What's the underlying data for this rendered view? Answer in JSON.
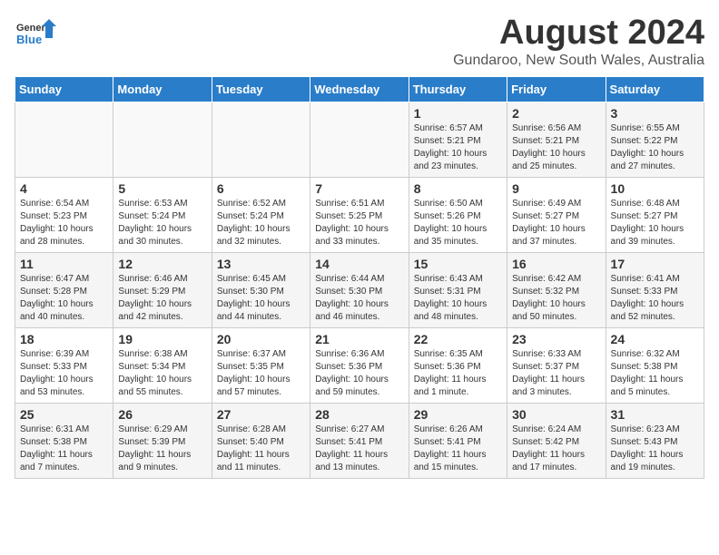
{
  "logo": {
    "line1": "General",
    "line2": "Blue"
  },
  "title": "August 2024",
  "subtitle": "Gundaroo, New South Wales, Australia",
  "days_of_week": [
    "Sunday",
    "Monday",
    "Tuesday",
    "Wednesday",
    "Thursday",
    "Friday",
    "Saturday"
  ],
  "weeks": [
    [
      {
        "day": "",
        "info": ""
      },
      {
        "day": "",
        "info": ""
      },
      {
        "day": "",
        "info": ""
      },
      {
        "day": "",
        "info": ""
      },
      {
        "day": "1",
        "info": "Sunrise: 6:57 AM\nSunset: 5:21 PM\nDaylight: 10 hours\nand 23 minutes."
      },
      {
        "day": "2",
        "info": "Sunrise: 6:56 AM\nSunset: 5:21 PM\nDaylight: 10 hours\nand 25 minutes."
      },
      {
        "day": "3",
        "info": "Sunrise: 6:55 AM\nSunset: 5:22 PM\nDaylight: 10 hours\nand 27 minutes."
      }
    ],
    [
      {
        "day": "4",
        "info": "Sunrise: 6:54 AM\nSunset: 5:23 PM\nDaylight: 10 hours\nand 28 minutes."
      },
      {
        "day": "5",
        "info": "Sunrise: 6:53 AM\nSunset: 5:24 PM\nDaylight: 10 hours\nand 30 minutes."
      },
      {
        "day": "6",
        "info": "Sunrise: 6:52 AM\nSunset: 5:24 PM\nDaylight: 10 hours\nand 32 minutes."
      },
      {
        "day": "7",
        "info": "Sunrise: 6:51 AM\nSunset: 5:25 PM\nDaylight: 10 hours\nand 33 minutes."
      },
      {
        "day": "8",
        "info": "Sunrise: 6:50 AM\nSunset: 5:26 PM\nDaylight: 10 hours\nand 35 minutes."
      },
      {
        "day": "9",
        "info": "Sunrise: 6:49 AM\nSunset: 5:27 PM\nDaylight: 10 hours\nand 37 minutes."
      },
      {
        "day": "10",
        "info": "Sunrise: 6:48 AM\nSunset: 5:27 PM\nDaylight: 10 hours\nand 39 minutes."
      }
    ],
    [
      {
        "day": "11",
        "info": "Sunrise: 6:47 AM\nSunset: 5:28 PM\nDaylight: 10 hours\nand 40 minutes."
      },
      {
        "day": "12",
        "info": "Sunrise: 6:46 AM\nSunset: 5:29 PM\nDaylight: 10 hours\nand 42 minutes."
      },
      {
        "day": "13",
        "info": "Sunrise: 6:45 AM\nSunset: 5:30 PM\nDaylight: 10 hours\nand 44 minutes."
      },
      {
        "day": "14",
        "info": "Sunrise: 6:44 AM\nSunset: 5:30 PM\nDaylight: 10 hours\nand 46 minutes."
      },
      {
        "day": "15",
        "info": "Sunrise: 6:43 AM\nSunset: 5:31 PM\nDaylight: 10 hours\nand 48 minutes."
      },
      {
        "day": "16",
        "info": "Sunrise: 6:42 AM\nSunset: 5:32 PM\nDaylight: 10 hours\nand 50 minutes."
      },
      {
        "day": "17",
        "info": "Sunrise: 6:41 AM\nSunset: 5:33 PM\nDaylight: 10 hours\nand 52 minutes."
      }
    ],
    [
      {
        "day": "18",
        "info": "Sunrise: 6:39 AM\nSunset: 5:33 PM\nDaylight: 10 hours\nand 53 minutes."
      },
      {
        "day": "19",
        "info": "Sunrise: 6:38 AM\nSunset: 5:34 PM\nDaylight: 10 hours\nand 55 minutes."
      },
      {
        "day": "20",
        "info": "Sunrise: 6:37 AM\nSunset: 5:35 PM\nDaylight: 10 hours\nand 57 minutes."
      },
      {
        "day": "21",
        "info": "Sunrise: 6:36 AM\nSunset: 5:36 PM\nDaylight: 10 hours\nand 59 minutes."
      },
      {
        "day": "22",
        "info": "Sunrise: 6:35 AM\nSunset: 5:36 PM\nDaylight: 11 hours\nand 1 minute."
      },
      {
        "day": "23",
        "info": "Sunrise: 6:33 AM\nSunset: 5:37 PM\nDaylight: 11 hours\nand 3 minutes."
      },
      {
        "day": "24",
        "info": "Sunrise: 6:32 AM\nSunset: 5:38 PM\nDaylight: 11 hours\nand 5 minutes."
      }
    ],
    [
      {
        "day": "25",
        "info": "Sunrise: 6:31 AM\nSunset: 5:38 PM\nDaylight: 11 hours\nand 7 minutes."
      },
      {
        "day": "26",
        "info": "Sunrise: 6:29 AM\nSunset: 5:39 PM\nDaylight: 11 hours\nand 9 minutes."
      },
      {
        "day": "27",
        "info": "Sunrise: 6:28 AM\nSunset: 5:40 PM\nDaylight: 11 hours\nand 11 minutes."
      },
      {
        "day": "28",
        "info": "Sunrise: 6:27 AM\nSunset: 5:41 PM\nDaylight: 11 hours\nand 13 minutes."
      },
      {
        "day": "29",
        "info": "Sunrise: 6:26 AM\nSunset: 5:41 PM\nDaylight: 11 hours\nand 15 minutes."
      },
      {
        "day": "30",
        "info": "Sunrise: 6:24 AM\nSunset: 5:42 PM\nDaylight: 11 hours\nand 17 minutes."
      },
      {
        "day": "31",
        "info": "Sunrise: 6:23 AM\nSunset: 5:43 PM\nDaylight: 11 hours\nand 19 minutes."
      }
    ]
  ]
}
